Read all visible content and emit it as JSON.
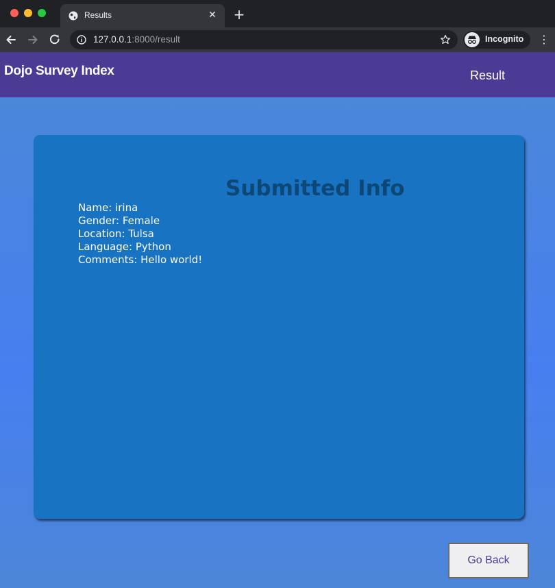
{
  "browser": {
    "tab_title": "Results",
    "url_host": "127.0.0.1",
    "url_rest": ":8000/result",
    "profile_label": "Incognito",
    "tab_icon": "globe-icon",
    "colors": {
      "chrome_dark": "#202124",
      "toolbar": "#35363a"
    }
  },
  "header": {
    "title": "Dojo Survey Index",
    "nav_link": "Result"
  },
  "card": {
    "title": "Submitted Info",
    "items": [
      "Name: irina",
      "Gender: Female",
      "Location: Tulsa",
      "Language: Python",
      "Comments: Hello world!"
    ]
  },
  "actions": {
    "go_back": "Go Back"
  },
  "colors": {
    "header_bg": "#4b3b95",
    "card_bg": "#1874c3",
    "card_title": "#0c4776",
    "page_bg": "#477ff0"
  }
}
